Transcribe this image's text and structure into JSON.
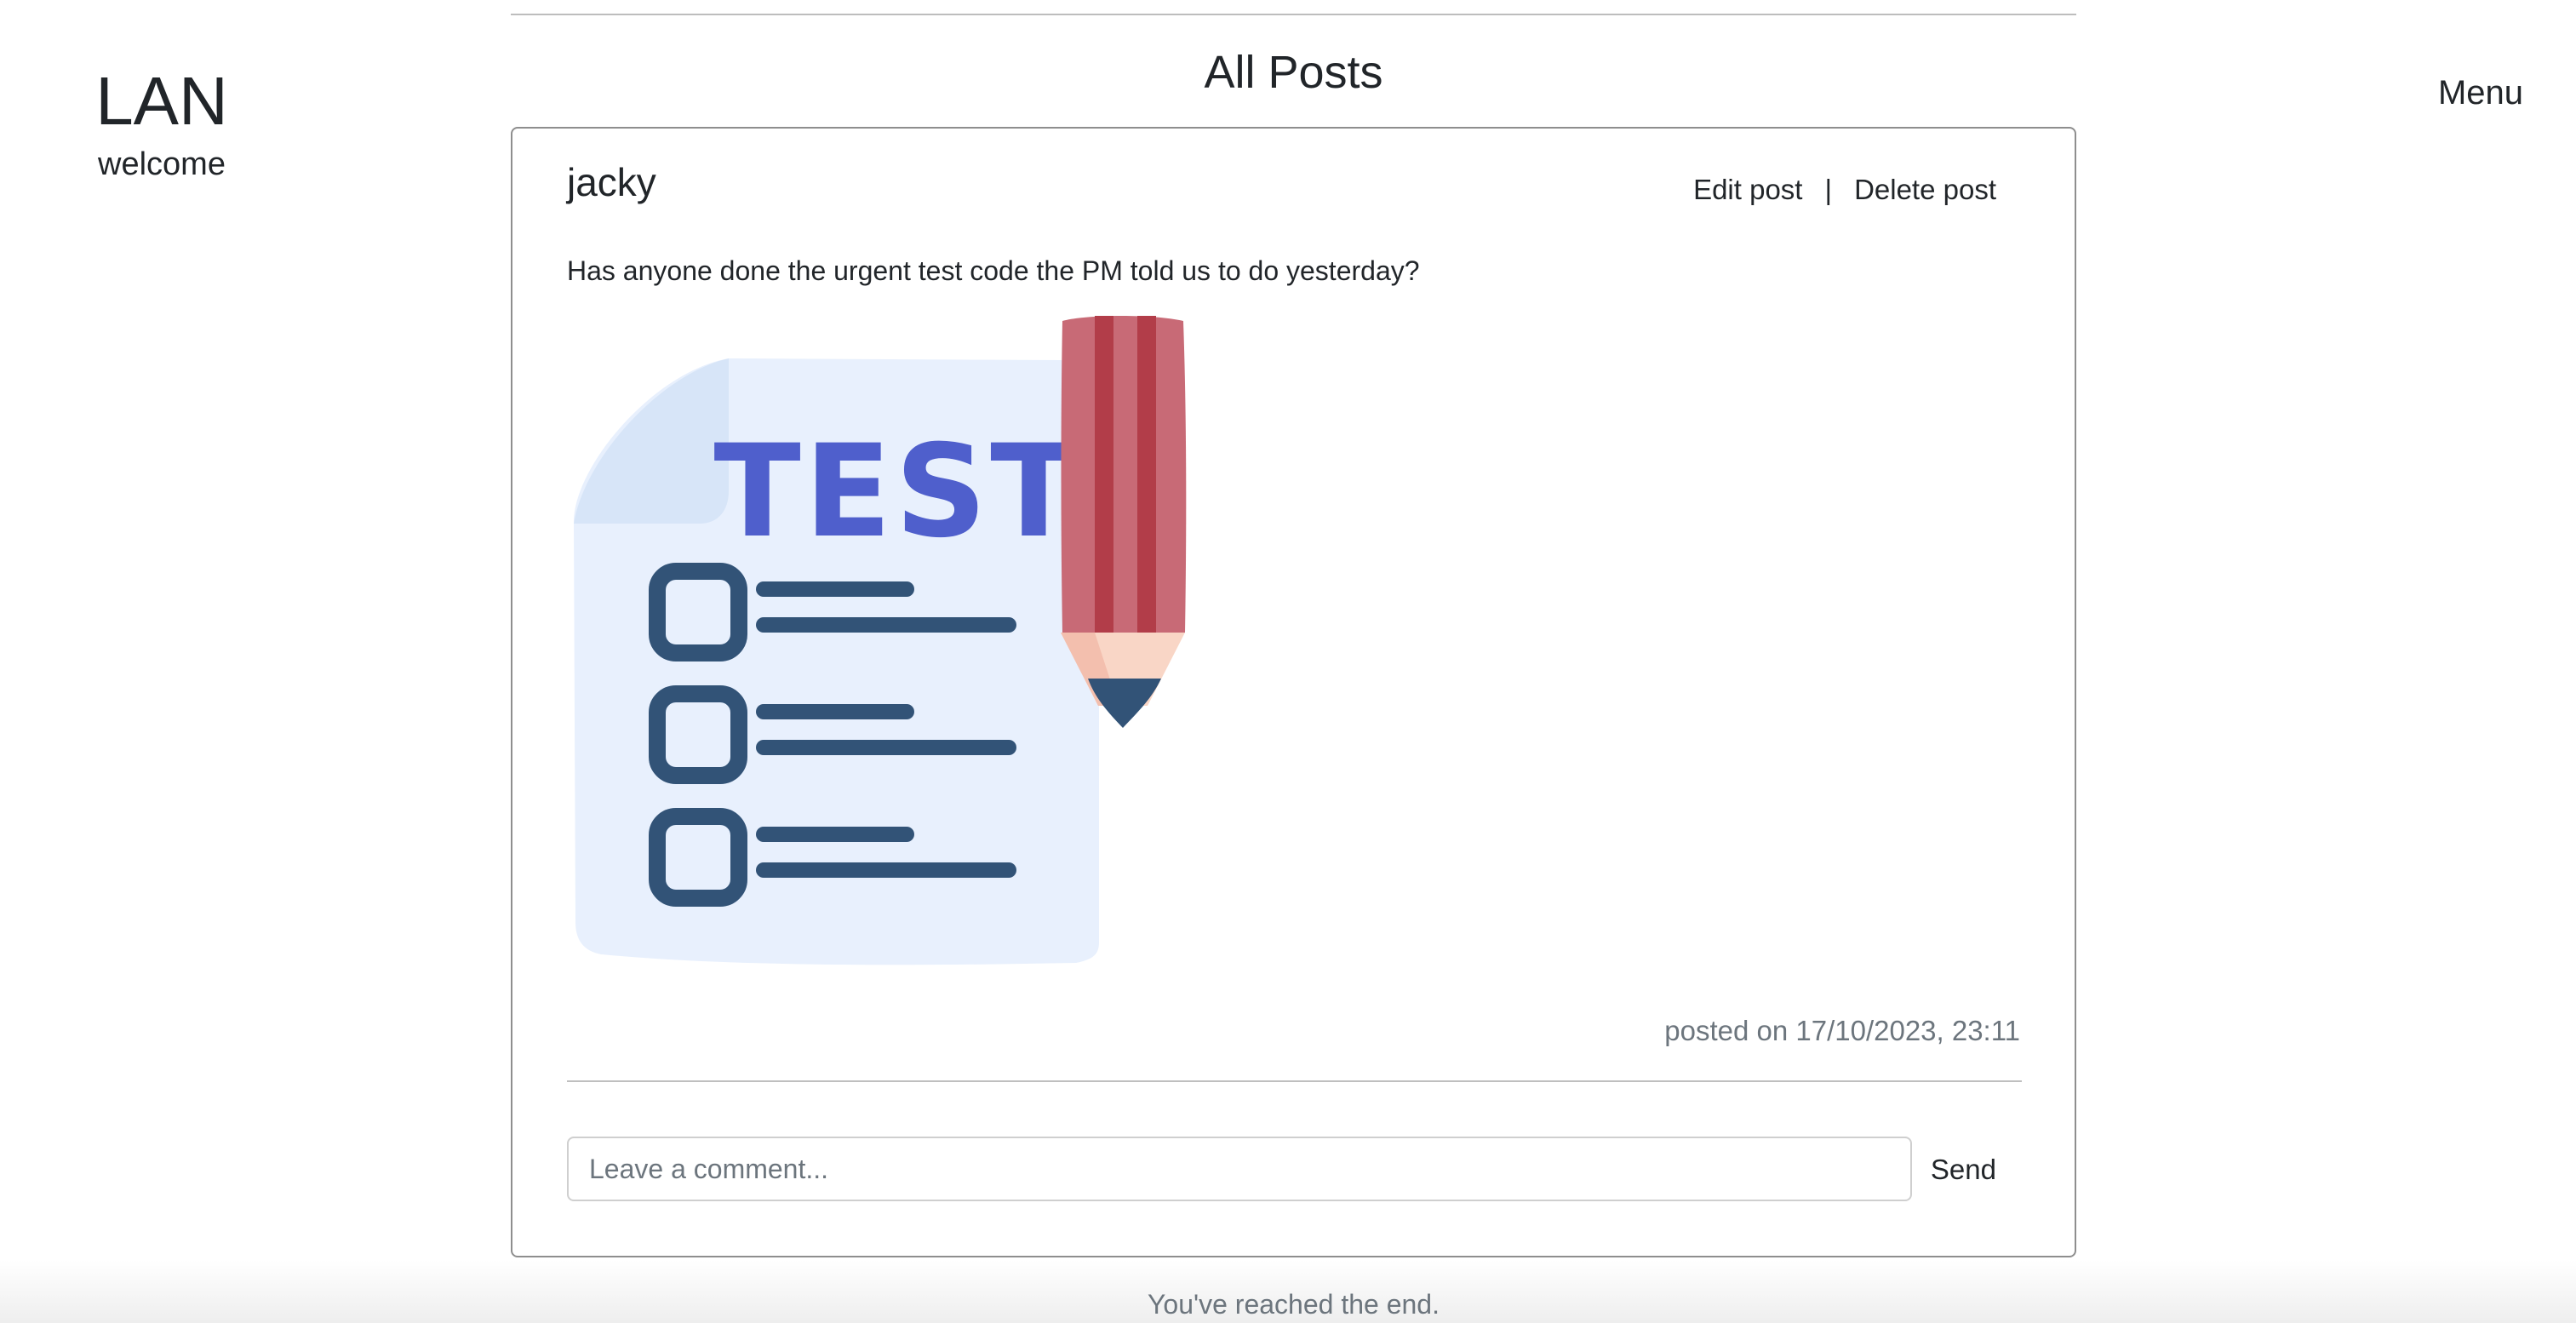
{
  "brand": {
    "title": "LAN",
    "subtitle": "welcome"
  },
  "nav": {
    "menu_label": "Menu"
  },
  "page": {
    "title": "All Posts",
    "end_message": "You've reached the end."
  },
  "post": {
    "author": "jacky",
    "actions": {
      "edit_label": "Edit post",
      "separator": "|",
      "delete_label": "Delete post"
    },
    "text": "Has anyone done the urgent test code the PM told us to do yesterday?",
    "image": {
      "icon_name": "test-checklist-with-pencil",
      "caption_text": "TEST"
    },
    "posted_on": "posted on 17/10/2023, 23:11"
  },
  "comment": {
    "placeholder": "Leave a comment...",
    "value": "",
    "send_label": "Send"
  },
  "colors": {
    "text_primary": "#212529",
    "text_muted": "#6c757d",
    "card_border": "#8e8e8e",
    "test_blue": "#4f5fcc",
    "checkbox_navy": "#325377",
    "paper_light": "#e8f0fd",
    "pencil_red": "#c85e6b"
  }
}
